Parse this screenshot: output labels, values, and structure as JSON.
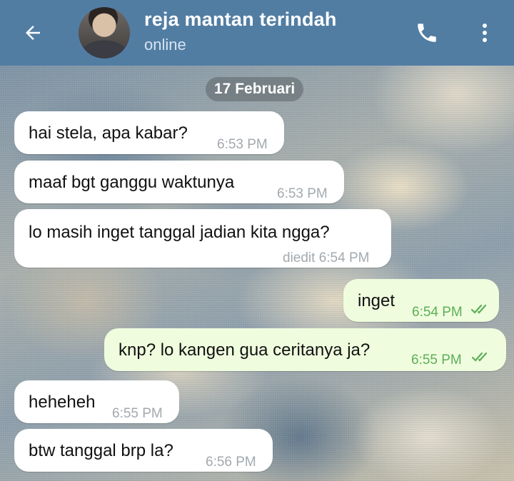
{
  "header": {
    "contact_name": "reja mantan terindah",
    "status": "online",
    "icons": {
      "back": "arrow-left-icon",
      "call": "phone-icon",
      "menu": "more-vertical-icon"
    }
  },
  "colors": {
    "header_bg": "#527da3",
    "incoming_bubble": "#ffffff",
    "outgoing_bubble": "#effdde",
    "outgoing_time": "#5cae57"
  },
  "date_separator": "17 Februari",
  "messages": [
    {
      "direction": "in",
      "text": "hai stela, apa kabar?",
      "time": "6:53 PM"
    },
    {
      "direction": "in",
      "text": "maaf bgt ganggu waktunya",
      "time": "6:53 PM"
    },
    {
      "direction": "in",
      "text": "lo masih inget tanggal jadian kita ngga?",
      "time": "diedit 6:54 PM"
    },
    {
      "direction": "out",
      "text": "inget",
      "time": "6:54 PM",
      "read": true
    },
    {
      "direction": "out",
      "text": "knp? lo kangen gua ceritanya ja?",
      "time": "6:55 PM",
      "read": true
    },
    {
      "direction": "in",
      "text": "heheheh",
      "time": "6:55 PM"
    },
    {
      "direction": "in",
      "text": "btw tanggal brp la?",
      "time": "6:56 PM"
    }
  ]
}
